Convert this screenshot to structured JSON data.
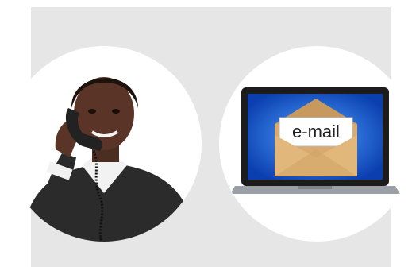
{
  "illustrations": {
    "left": {
      "icon": "person-on-phone-icon"
    },
    "right": {
      "icon": "laptop-email-icon",
      "card_text": "e-mail"
    }
  },
  "colors": {
    "panel": "#e6e6e6",
    "circle": "#ffffff",
    "screen": "#1b5fd6",
    "envelope": "#d9ab6f",
    "sweater": "#2a2a2a"
  }
}
